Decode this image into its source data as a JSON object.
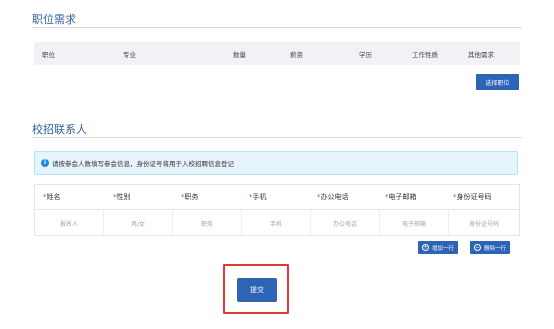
{
  "position_section": {
    "title": "职位需求",
    "columns": [
      "职位",
      "专业",
      "数量",
      "薪资",
      "学历",
      "工作性质",
      "其他需求"
    ],
    "select_button": "选择职位"
  },
  "contact_section": {
    "title": "校招联系人",
    "notice": "请按参会人数填写参会信息，身份证号将用于入校招聘信息登记",
    "columns": [
      {
        "label": "姓名",
        "placeholder": "报名人"
      },
      {
        "label": "性别",
        "placeholder": "男/女"
      },
      {
        "label": "职务",
        "placeholder": "职务"
      },
      {
        "label": "手机",
        "placeholder": "手机"
      },
      {
        "label": "办公电话",
        "placeholder": "办公电话"
      },
      {
        "label": "电子邮箱",
        "placeholder": "电子邮箱"
      },
      {
        "label": "身份证号码",
        "placeholder": "身份证号码"
      }
    ],
    "required_mark": "*",
    "add_row": "增加一行",
    "delete_row": "删除一行"
  },
  "submit_label": "提交",
  "colors": {
    "primary": "#2e64b5",
    "highlight": "#e53935",
    "title": "#2f5f9a"
  }
}
